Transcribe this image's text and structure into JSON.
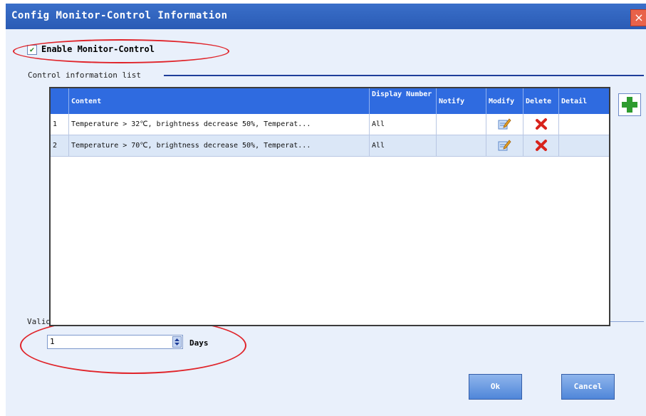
{
  "window": {
    "title": "Config Monitor-Control Information",
    "close_label": "×"
  },
  "enable": {
    "checked": true,
    "label": "Enable Monitor-Control"
  },
  "list_section": {
    "label": "Control information list"
  },
  "table": {
    "columns": [
      "Content",
      "Display Number",
      "Notify",
      "Modify",
      "Delete",
      "Detail"
    ],
    "rows": [
      {
        "index": "1",
        "content": "Temperature > 32℃, brightness decrease 50%, Temperat...",
        "display_number": "All",
        "notify": "",
        "detail": ""
      },
      {
        "index": "2",
        "content": "Temperature > 70℃, brightness decrease 50%, Temperat...",
        "display_number": "All",
        "notify": "",
        "detail": ""
      }
    ]
  },
  "logs_section": {
    "label": "Valid days of logs",
    "value": "1",
    "unit": "Days"
  },
  "buttons": {
    "ok": "Ok",
    "cancel": "Cancel"
  },
  "colors": {
    "title_bar": "#2a5bb5",
    "header": "#2f6be0",
    "highlight_ellipse": "#e0242a",
    "delete_icon": "#d8231c",
    "add_icon": "#2e9b2e"
  },
  "icons": [
    "close-icon",
    "check-icon",
    "add-icon",
    "edit-icon",
    "delete-icon",
    "spin-up-icon",
    "spin-down-icon"
  ]
}
